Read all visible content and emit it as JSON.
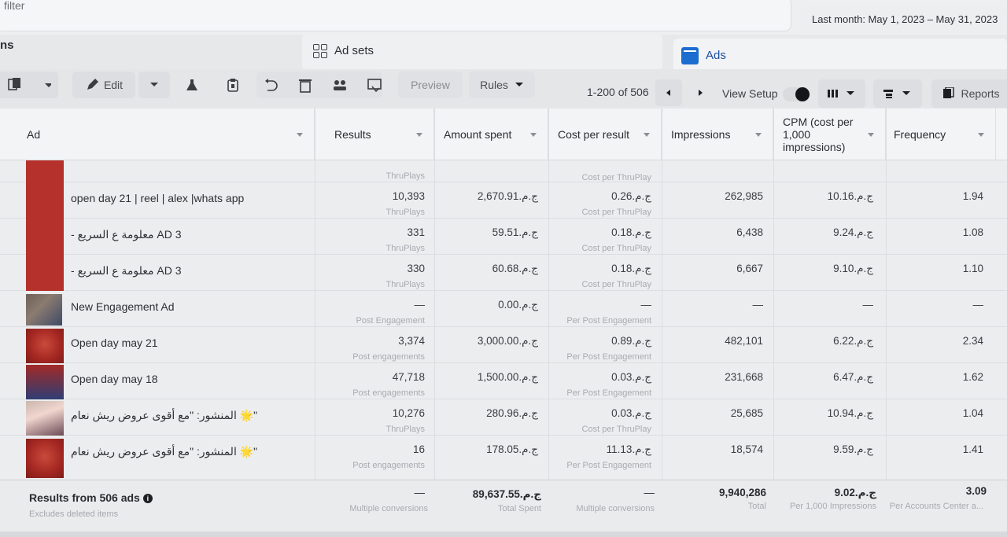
{
  "filter": {
    "placeholder": "filter"
  },
  "date_range": "Last month: May 1, 2023 – May 31, 2023",
  "nav": {
    "campaigns_tab": "ns",
    "adsets_tab": "Ad sets",
    "ads_tab": "Ads"
  },
  "toolbar": {
    "edit_label": "Edit",
    "preview_label": "Preview",
    "rules_label": "Rules",
    "pagination": "1-200 of 506",
    "view_setup_label": "View Setup",
    "reports_label": "Reports"
  },
  "columns": {
    "ad": "Ad",
    "results": "Results",
    "amount_spent": "Amount spent",
    "cost_per_result": "Cost per result",
    "impressions": "Impressions",
    "cpm_line1": "CPM (cost per",
    "cpm_line2": "1,000",
    "cpm_line3": "impressions)",
    "frequency": "Frequency"
  },
  "rows": [
    {
      "name": "open day 21 | reel | alex |whats app",
      "results": "10,393",
      "results_type": "ThruPlays",
      "spent": "2,670.91ج.م.‏",
      "cpr": "0.26ج.م.‏",
      "cpr_type": "Cost per ThruPlay",
      "impressions": "262,985",
      "cpm": "10.16ج.م.‏",
      "frequency": "1.94"
    },
    {
      "name": "- معلومة ع السريع AD 3",
      "results": "331",
      "results_type": "ThruPlays",
      "spent": "59.51ج.م.‏",
      "cpr": "0.18ج.م.‏",
      "cpr_type": "Cost per ThruPlay",
      "impressions": "6,438",
      "cpm": "9.24ج.م.‏",
      "frequency": "1.08"
    },
    {
      "name": "- معلومة ع السريع AD 3",
      "results": "330",
      "results_type": "ThruPlays",
      "spent": "60.68ج.م.‏",
      "cpr": "0.18ج.م.‏",
      "cpr_type": "Cost per ThruPlay",
      "impressions": "6,667",
      "cpm": "9.10ج.م.‏",
      "frequency": "1.10"
    },
    {
      "name": "New Engagement Ad",
      "results": "—",
      "results_type": "Post Engagement",
      "spent": "0.00ج.م.‏",
      "cpr": "—",
      "cpr_type": "Per Post Engagement",
      "impressions": "—",
      "cpm": "—",
      "frequency": "—"
    },
    {
      "name": "Open day may 21",
      "results": "3,374",
      "results_type": "Post engagements",
      "spent": "3,000.00ج.م.‏",
      "cpr": "0.89ج.م.‏",
      "cpr_type": "Per Post Engagement",
      "impressions": "482,101",
      "cpm": "6.22ج.م.‏",
      "frequency": "2.34"
    },
    {
      "name": "Open day may 18",
      "results": "47,718",
      "results_type": "Post engagements",
      "spent": "1,500.00ج.م.‏",
      "cpr": "0.03ج.م.‏",
      "cpr_type": "Per Post Engagement",
      "impressions": "231,668",
      "cpm": "6.47ج.م.‏",
      "frequency": "1.62"
    },
    {
      "name": "المنشور: \"مع أقوى عروض ريش نعام 🌟\"",
      "results": "10,276",
      "results_type": "ThruPlays",
      "spent": "280.96ج.م.‏",
      "cpr": "0.03ج.م.‏",
      "cpr_type": "Cost per ThruPlay",
      "impressions": "25,685",
      "cpm": "10.94ج.م.‏",
      "frequency": "1.04"
    },
    {
      "name": "المنشور: \"مع أقوى عروض ريش نعام 🌟\"",
      "results": "16",
      "results_type": "Post engagements",
      "spent": "178.05ج.م.‏",
      "cpr": "11.13ج.م.‏",
      "cpr_type": "Per Post Engagement",
      "impressions": "18,574",
      "cpm": "9.59ج.م.‏",
      "frequency": "1.41"
    }
  ],
  "top_partial_row": {
    "results_type": "ThruPlays",
    "cpr_type": "Cost per ThruPlay"
  },
  "footer": {
    "title": "Results from 506 ads",
    "subtitle": "Excludes deleted items",
    "results": "—",
    "results_sub": "Multiple conversions",
    "spent": "89,637.55ج.م.‏",
    "spent_sub": "Total Spent",
    "cpr": "—",
    "cpr_sub": "Multiple conversions",
    "impressions": "9,940,286",
    "impressions_sub": "Total",
    "cpm": "9.02ج.م.‏",
    "cpm_sub": "Per 1,000 Impressions",
    "frequency": "3.09",
    "frequency_sub": "Per Accounts Center a..."
  }
}
